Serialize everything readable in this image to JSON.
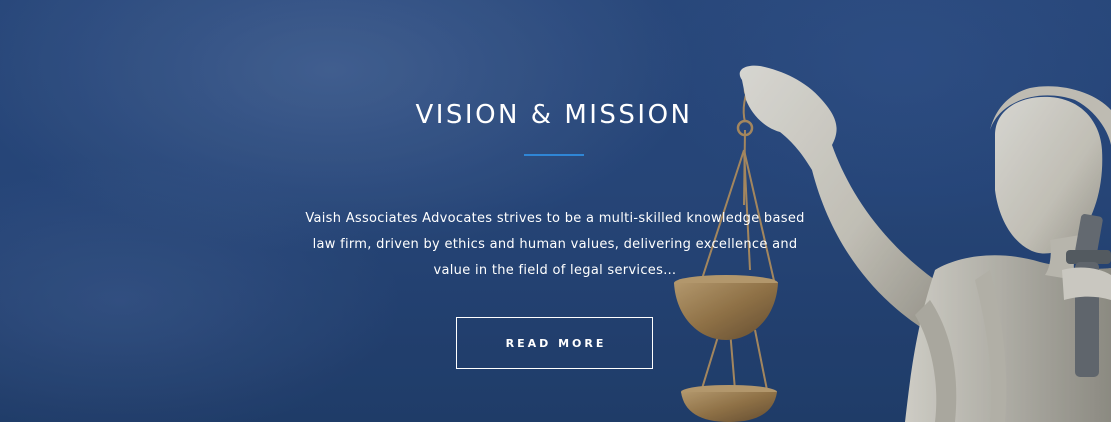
{
  "hero": {
    "title": "VISION & MISSION",
    "description": "Vaish Associates Advocates strives to be a multi-skilled knowledge based law firm, driven by ethics and human values, delivering excellence and value in the field of legal services…",
    "button_label": "READ MORE",
    "background_image": "lady-justice-statue-holding-scales",
    "colors": {
      "sky": "#2c4d84",
      "accent_divider": "#2f86d6",
      "text": "#ffffff"
    }
  }
}
